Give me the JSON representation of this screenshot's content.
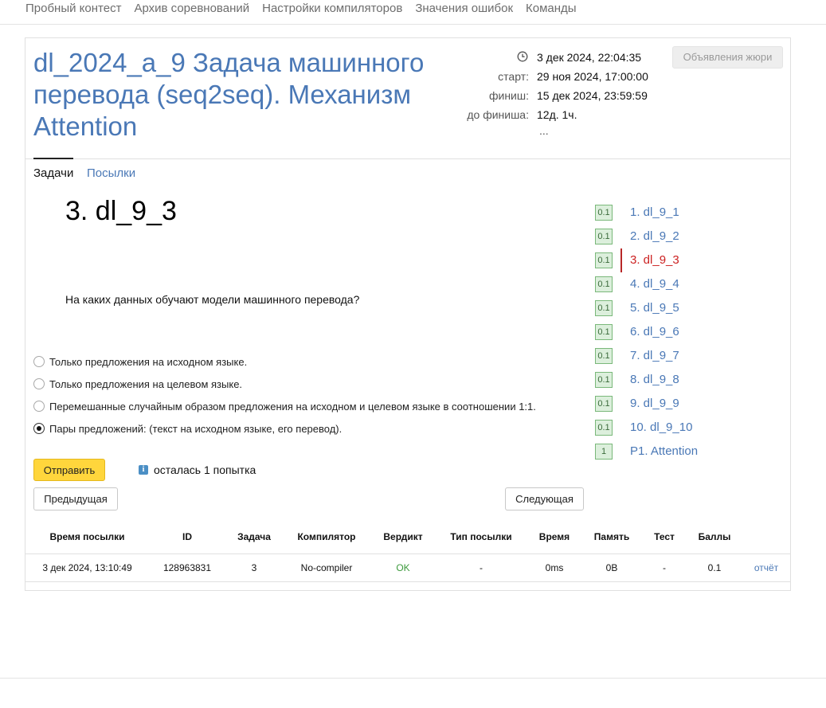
{
  "topnav": {
    "items": [
      "Пробный контест",
      "Архив соревнований",
      "Настройки компиляторов",
      "Значения ошибок",
      "Команды"
    ]
  },
  "contest": {
    "title": "dl_2024_a_9 Задача машинного перевода (seq2seq). Механизм Attention",
    "current_time": "3 дек 2024, 22:04:35",
    "start_label": "старт:",
    "start_value": "29 ноя 2024, 17:00:00",
    "finish_label": "финиш:",
    "finish_value": "15 дек 2024, 23:59:59",
    "remaining_label": "до финиша:",
    "remaining_value": "12д. 1ч.",
    "more": "...",
    "jury_button": "Объявления жюри"
  },
  "icons": {
    "clock": "clock-icon",
    "info": "info-icon"
  },
  "tabs": [
    "Задачи",
    "Посылки"
  ],
  "problem": {
    "title": "3. dl_9_3",
    "question": "На каких данных обучают модели машинного перевода?",
    "options": [
      {
        "label": "Только предложения на исходном языке.",
        "checked": false
      },
      {
        "label": "Только предложения на целевом языке.",
        "checked": false
      },
      {
        "label": "Перемешанные случайным образом предложения на исходном и целевом языке в соотношении 1:1.",
        "checked": false
      },
      {
        "label": "Пары предложений: (текст на исходном языке, его перевод).",
        "checked": true
      }
    ],
    "submit": "Отправить",
    "info_glyph": "i",
    "attempts": "осталась 1 попытка",
    "prev": "Предыдущая",
    "next": "Следующая"
  },
  "problem_list": [
    {
      "score": "0.1",
      "label": "1. dl_9_1"
    },
    {
      "score": "0.1",
      "label": "2. dl_9_2"
    },
    {
      "score": "0.1",
      "label": "3. dl_9_3",
      "active": true
    },
    {
      "score": "0.1",
      "label": "4. dl_9_4"
    },
    {
      "score": "0.1",
      "label": "5. dl_9_5"
    },
    {
      "score": "0.1",
      "label": "6. dl_9_6"
    },
    {
      "score": "0.1",
      "label": "7. dl_9_7"
    },
    {
      "score": "0.1",
      "label": "8. dl_9_8"
    },
    {
      "score": "0.1",
      "label": "9. dl_9_9"
    },
    {
      "score": "0.1",
      "label": "10. dl_9_10"
    },
    {
      "score": "1",
      "label": "P1. Attention"
    }
  ],
  "submissions": {
    "headers": [
      "Время посылки",
      "ID",
      "Задача",
      "Компилятор",
      "Вердикт",
      "Тип посылки",
      "Время",
      "Память",
      "Тест",
      "Баллы"
    ],
    "rows": [
      [
        "3 дек 2024, 13:10:49",
        "128963831",
        "3",
        "No-compiler",
        "OK",
        "-",
        "0ms",
        "0B",
        "-",
        "0.1",
        "отчёт"
      ]
    ]
  },
  "colors": {
    "link": "#4a78b6",
    "active_problem": "#cc2222",
    "submit_button": "#ffd63c",
    "verdict_ok": "#3c9a3c",
    "score_badge": "#dcefdc"
  }
}
